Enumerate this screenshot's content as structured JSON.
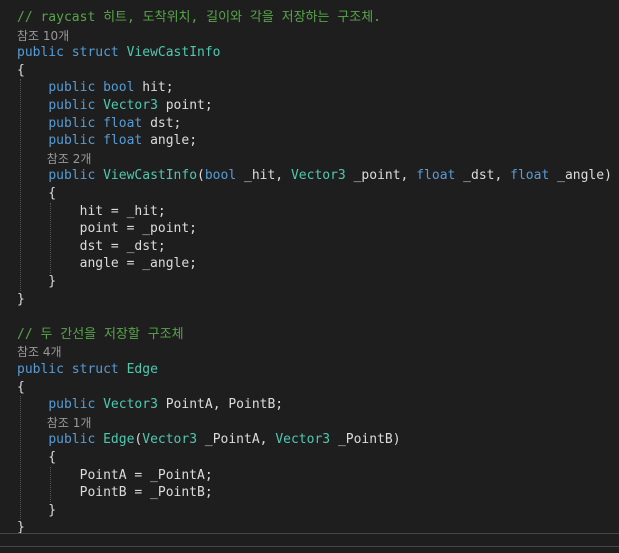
{
  "colors": {
    "background": "#1e1e1e",
    "keyword": "#569cd6",
    "type": "#4ec9b0",
    "comment": "#57a64a",
    "plain": "#dcdcdc",
    "codelens": "#999999",
    "indent_guide": "#555555"
  },
  "code_lines": [
    {
      "kind": "code",
      "tokens": [
        {
          "t": "// raycast 히트, 도착위치, 길이와 각을 저장하는 구조체.",
          "k": "comment"
        }
      ]
    },
    {
      "kind": "codelens",
      "text": "참조 10개"
    },
    {
      "kind": "code",
      "tokens": [
        {
          "t": "public",
          "k": "keyword"
        },
        {
          "t": " ",
          "k": "plain"
        },
        {
          "t": "struct",
          "k": "keyword"
        },
        {
          "t": " ",
          "k": "plain"
        },
        {
          "t": "ViewCastInfo",
          "k": "type"
        }
      ]
    },
    {
      "kind": "code",
      "tokens": [
        {
          "t": "{",
          "k": "plain"
        }
      ]
    },
    {
      "kind": "code",
      "tokens": [
        {
          "t": "    ",
          "k": "plain"
        },
        {
          "t": "public",
          "k": "keyword"
        },
        {
          "t": " ",
          "k": "plain"
        },
        {
          "t": "bool",
          "k": "keyword"
        },
        {
          "t": " hit;",
          "k": "plain"
        }
      ]
    },
    {
      "kind": "code",
      "tokens": [
        {
          "t": "    ",
          "k": "plain"
        },
        {
          "t": "public",
          "k": "keyword"
        },
        {
          "t": " ",
          "k": "plain"
        },
        {
          "t": "Vector3",
          "k": "type"
        },
        {
          "t": " point;",
          "k": "plain"
        }
      ]
    },
    {
      "kind": "code",
      "tokens": [
        {
          "t": "    ",
          "k": "plain"
        },
        {
          "t": "public",
          "k": "keyword"
        },
        {
          "t": " ",
          "k": "plain"
        },
        {
          "t": "float",
          "k": "keyword"
        },
        {
          "t": " dst;",
          "k": "plain"
        }
      ]
    },
    {
      "kind": "code",
      "tokens": [
        {
          "t": "    ",
          "k": "plain"
        },
        {
          "t": "public",
          "k": "keyword"
        },
        {
          "t": " ",
          "k": "plain"
        },
        {
          "t": "float",
          "k": "keyword"
        },
        {
          "t": " angle;",
          "k": "plain"
        }
      ]
    },
    {
      "kind": "codelens",
      "indent": 4,
      "text": "참조 2개"
    },
    {
      "kind": "code",
      "tokens": [
        {
          "t": "    ",
          "k": "plain"
        },
        {
          "t": "public",
          "k": "keyword"
        },
        {
          "t": " ",
          "k": "plain"
        },
        {
          "t": "ViewCastInfo",
          "k": "type"
        },
        {
          "t": "(",
          "k": "plain"
        },
        {
          "t": "bool",
          "k": "keyword"
        },
        {
          "t": " _hit, ",
          "k": "plain"
        },
        {
          "t": "Vector3",
          "k": "type"
        },
        {
          "t": " _point, ",
          "k": "plain"
        },
        {
          "t": "float",
          "k": "keyword"
        },
        {
          "t": " _dst, ",
          "k": "plain"
        },
        {
          "t": "float",
          "k": "keyword"
        },
        {
          "t": " _angle)",
          "k": "plain"
        }
      ]
    },
    {
      "kind": "code",
      "tokens": [
        {
          "t": "    {",
          "k": "plain"
        }
      ]
    },
    {
      "kind": "code",
      "tokens": [
        {
          "t": "        hit = _hit;",
          "k": "plain"
        }
      ]
    },
    {
      "kind": "code",
      "tokens": [
        {
          "t": "        point = _point;",
          "k": "plain"
        }
      ]
    },
    {
      "kind": "code",
      "tokens": [
        {
          "t": "        dst = _dst;",
          "k": "plain"
        }
      ]
    },
    {
      "kind": "code",
      "tokens": [
        {
          "t": "        angle = _angle;",
          "k": "plain"
        }
      ]
    },
    {
      "kind": "code",
      "tokens": [
        {
          "t": "    }",
          "k": "plain"
        }
      ]
    },
    {
      "kind": "code",
      "tokens": [
        {
          "t": "}",
          "k": "plain"
        }
      ]
    },
    {
      "kind": "blank"
    },
    {
      "kind": "code",
      "tokens": [
        {
          "t": "// 두 간선을 저장할 구조체",
          "k": "comment"
        }
      ]
    },
    {
      "kind": "codelens",
      "text": "참조 4개"
    },
    {
      "kind": "code",
      "tokens": [
        {
          "t": "public",
          "k": "keyword"
        },
        {
          "t": " ",
          "k": "plain"
        },
        {
          "t": "struct",
          "k": "keyword"
        },
        {
          "t": " ",
          "k": "plain"
        },
        {
          "t": "Edge",
          "k": "type"
        }
      ]
    },
    {
      "kind": "code",
      "tokens": [
        {
          "t": "{",
          "k": "plain"
        }
      ]
    },
    {
      "kind": "code",
      "tokens": [
        {
          "t": "    ",
          "k": "plain"
        },
        {
          "t": "public",
          "k": "keyword"
        },
        {
          "t": " ",
          "k": "plain"
        },
        {
          "t": "Vector3",
          "k": "type"
        },
        {
          "t": " PointA, PointB;",
          "k": "plain"
        }
      ]
    },
    {
      "kind": "codelens",
      "indent": 4,
      "text": "참조 1개"
    },
    {
      "kind": "code",
      "tokens": [
        {
          "t": "    ",
          "k": "plain"
        },
        {
          "t": "public",
          "k": "keyword"
        },
        {
          "t": " ",
          "k": "plain"
        },
        {
          "t": "Edge",
          "k": "type"
        },
        {
          "t": "(",
          "k": "plain"
        },
        {
          "t": "Vector3",
          "k": "type"
        },
        {
          "t": " _PointA, ",
          "k": "plain"
        },
        {
          "t": "Vector3",
          "k": "type"
        },
        {
          "t": " _PointB)",
          "k": "plain"
        }
      ]
    },
    {
      "kind": "code",
      "tokens": [
        {
          "t": "    {",
          "k": "plain"
        }
      ]
    },
    {
      "kind": "code",
      "tokens": [
        {
          "t": "        PointA = _PointA;",
          "k": "plain"
        }
      ]
    },
    {
      "kind": "code",
      "tokens": [
        {
          "t": "        PointB = _PointB;",
          "k": "plain"
        }
      ]
    },
    {
      "kind": "code",
      "tokens": [
        {
          "t": "    }",
          "k": "plain"
        }
      ]
    },
    {
      "kind": "code",
      "tokens": [
        {
          "t": "}",
          "k": "plain"
        }
      ]
    }
  ]
}
